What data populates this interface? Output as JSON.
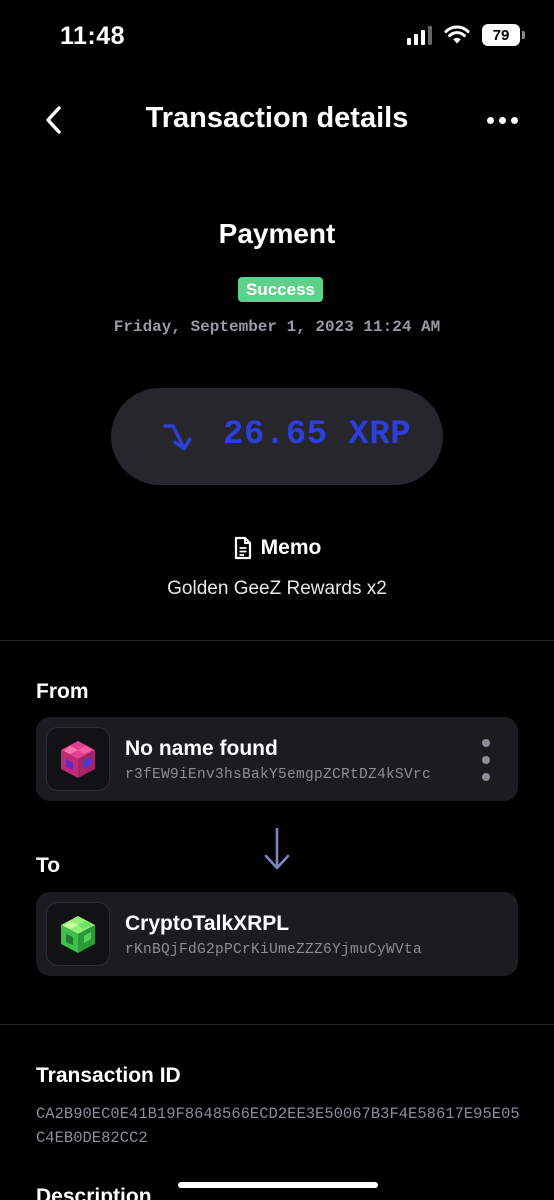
{
  "status_bar": {
    "time": "11:48",
    "battery": "79"
  },
  "header": {
    "title": "Transaction details"
  },
  "transaction": {
    "type": "Payment",
    "status": "Success",
    "date": "Friday, September 1, 2023 11:24 AM",
    "amount": "26.65 XRP"
  },
  "memo": {
    "label": "Memo",
    "value": "Golden GeeZ Rewards x2"
  },
  "from": {
    "label": "From",
    "name": "No name found",
    "address": "r3fEW9iEnv3hsBakY5emgpZCRtDZ4kSVrc"
  },
  "to": {
    "label": "To",
    "name": "CryptoTalkXRPL",
    "address": "rKnBQjFdG2pPCrKiUmeZZZ6YjmuCyWVta"
  },
  "transaction_id": {
    "label": "Transaction ID",
    "value": "CA2B90EC0E41B19F8648566ECD2EE3E50067B3F4E58617E95E05C4EB0DE82CC2"
  },
  "description": {
    "label": "Description"
  },
  "colors": {
    "background": "#000000",
    "success": "#5fd08a",
    "amount": "#2e3ed8",
    "card": "#1c1c20",
    "pill": "#26262c"
  }
}
